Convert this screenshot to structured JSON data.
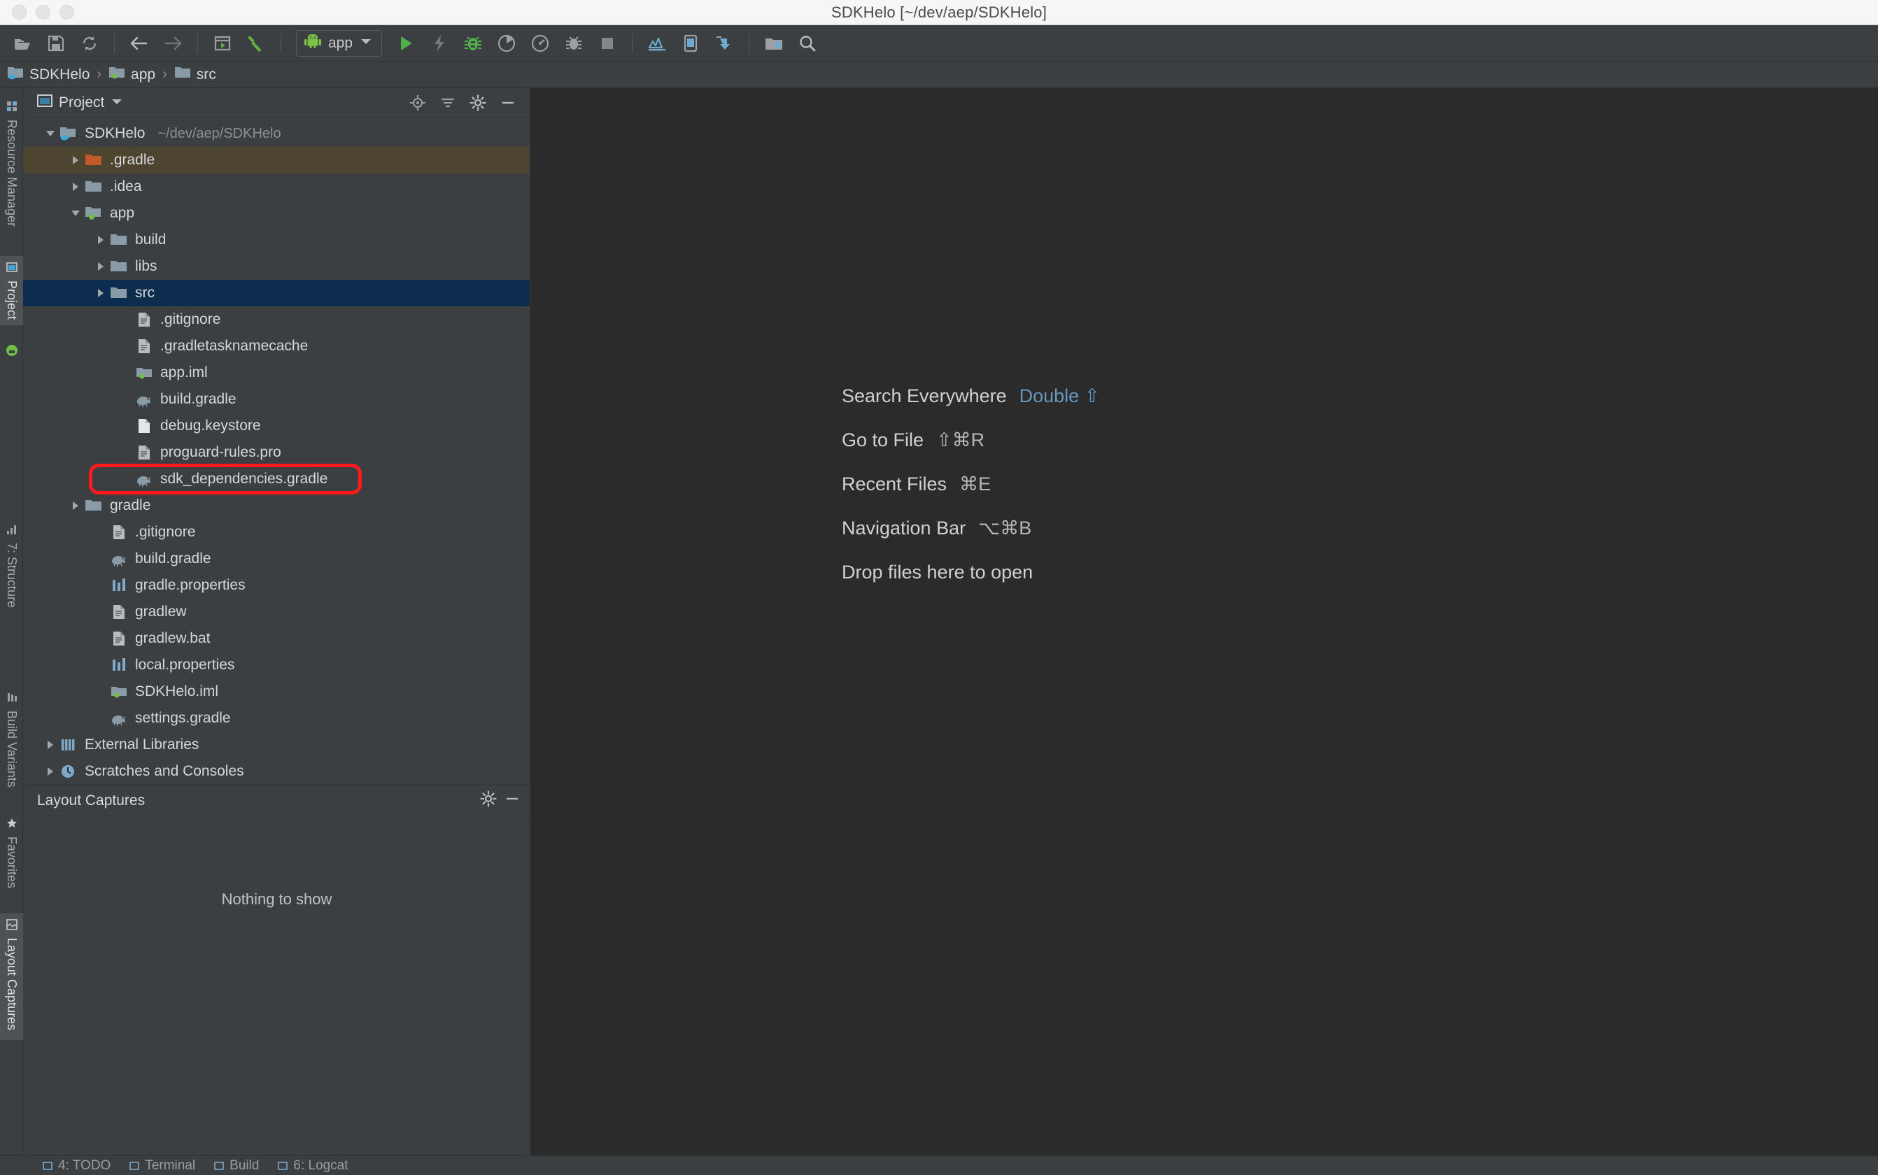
{
  "window": {
    "title": "SDKHelo [~/dev/aep/SDKHelo]",
    "controls": [
      "close-button",
      "minimize-button",
      "zoom-button"
    ]
  },
  "toolbar": {
    "buttons": [
      {
        "name": "open-project-icon",
        "tooltip": "Open"
      },
      {
        "name": "save-all-icon",
        "tooltip": "Save All"
      },
      {
        "name": "sync-icon",
        "tooltip": "Synchronize"
      },
      {
        "name": "back-arrow-icon",
        "tooltip": "Back"
      },
      {
        "name": "forward-arrow-icon",
        "tooltip": "Forward"
      },
      {
        "name": "project-structure-icon",
        "tooltip": "Project Structure"
      },
      {
        "name": "build-hammer-icon",
        "tooltip": "Make Project"
      },
      {
        "name": "run-icon",
        "tooltip": "Run"
      },
      {
        "name": "apply-changes-icon",
        "tooltip": "Apply Changes"
      },
      {
        "name": "debug-icon",
        "tooltip": "Debug"
      },
      {
        "name": "run-coverage-icon",
        "tooltip": "Run with Coverage"
      },
      {
        "name": "profiler-icon",
        "tooltip": "Profile"
      },
      {
        "name": "attach-debugger-icon",
        "tooltip": "Attach Debugger"
      },
      {
        "name": "stop-icon",
        "tooltip": "Stop"
      },
      {
        "name": "sdk-manager-icon",
        "tooltip": "SDK Manager"
      },
      {
        "name": "avd-manager-icon",
        "tooltip": "AVD Manager"
      },
      {
        "name": "sync-gradle-icon",
        "tooltip": "Sync Project with Gradle Files"
      },
      {
        "name": "device-file-explorer-icon",
        "tooltip": "Device File Explorer"
      },
      {
        "name": "search-everywhere-icon",
        "tooltip": "Search Everywhere"
      }
    ],
    "run_config": {
      "label": "app",
      "icon": "android-robot-icon",
      "dropdown": "chevron-down-icon"
    }
  },
  "breadcrumb": {
    "items": [
      {
        "label": "SDKHelo",
        "icon": "module-java-folder-icon"
      },
      {
        "label": "app",
        "icon": "module-android-folder-icon"
      },
      {
        "label": "src",
        "icon": "folder-icon"
      }
    ],
    "separator": "›"
  },
  "left_stripe": {
    "tabs": [
      {
        "label": "Resource Manager",
        "selected": false,
        "icon": "resource-manager-icon"
      },
      {
        "label": "Project",
        "selected": true,
        "icon": "project-icon"
      },
      {
        "label": "7: Structure",
        "selected": false,
        "icon": "structure-icon"
      },
      {
        "label": "Build Variants",
        "selected": false,
        "icon": "build-variants-icon"
      },
      {
        "label": "Favorites",
        "selected": false,
        "icon": "star-icon"
      },
      {
        "label": "Layout Captures",
        "selected": true,
        "icon": "layout-captures-icon"
      }
    ]
  },
  "project_panel": {
    "title": "Project",
    "title_dropdown": "chevron-down-icon",
    "header_actions": [
      {
        "name": "locate-icon",
        "label": "Select Opened File"
      },
      {
        "name": "collapse-all-icon",
        "label": "Collapse All"
      },
      {
        "name": "gear-icon",
        "label": "Settings"
      },
      {
        "name": "minimize-icon",
        "label": "Hide"
      }
    ],
    "tree": [
      {
        "label": "SDKHelo",
        "path": "~/dev/aep/SDKHelo",
        "indent": 0,
        "arrow": "down",
        "icon": "module-java-folder-icon",
        "state": "none"
      },
      {
        "label": ".gradle",
        "path": "",
        "indent": 1,
        "arrow": "right",
        "icon": "folder-orange-icon",
        "state": "brown"
      },
      {
        "label": ".idea",
        "path": "",
        "indent": 1,
        "arrow": "right",
        "icon": "folder-icon",
        "state": "none"
      },
      {
        "label": "app",
        "path": "",
        "indent": 1,
        "arrow": "down",
        "icon": "module-android-folder-icon",
        "state": "none"
      },
      {
        "label": "build",
        "path": "",
        "indent": 2,
        "arrow": "right",
        "icon": "folder-icon",
        "state": "none"
      },
      {
        "label": "libs",
        "path": "",
        "indent": 2,
        "arrow": "right",
        "icon": "folder-icon",
        "state": "none"
      },
      {
        "label": "src",
        "path": "",
        "indent": 2,
        "arrow": "right",
        "icon": "folder-icon",
        "state": "blue"
      },
      {
        "label": ".gitignore",
        "path": "",
        "indent": 3,
        "arrow": "none",
        "icon": "text-file-icon",
        "state": "none"
      },
      {
        "label": ".gradletasknamecache",
        "path": "",
        "indent": 3,
        "arrow": "none",
        "icon": "text-file-icon",
        "state": "none"
      },
      {
        "label": "app.iml",
        "path": "",
        "indent": 3,
        "arrow": "none",
        "icon": "iml-file-icon",
        "state": "none"
      },
      {
        "label": "build.gradle",
        "path": "",
        "indent": 3,
        "arrow": "none",
        "icon": "gradle-file-icon",
        "state": "none"
      },
      {
        "label": "debug.keystore",
        "path": "",
        "indent": 3,
        "arrow": "none",
        "icon": "blank-file-icon",
        "state": "none"
      },
      {
        "label": "proguard-rules.pro",
        "path": "",
        "indent": 3,
        "arrow": "none",
        "icon": "text-file-icon",
        "state": "none"
      },
      {
        "label": "sdk_dependencies.gradle",
        "path": "",
        "indent": 3,
        "arrow": "none",
        "icon": "gradle-file-icon",
        "state": "annotated"
      },
      {
        "label": "gradle",
        "path": "",
        "indent": 1,
        "arrow": "right",
        "icon": "folder-icon",
        "state": "none"
      },
      {
        "label": ".gitignore",
        "path": "",
        "indent": 2,
        "arrow": "none",
        "icon": "text-file-icon",
        "state": "none"
      },
      {
        "label": "build.gradle",
        "path": "",
        "indent": 2,
        "arrow": "none",
        "icon": "gradle-file-icon",
        "state": "none"
      },
      {
        "label": "gradle.properties",
        "path": "",
        "indent": 2,
        "arrow": "none",
        "icon": "properties-file-icon",
        "state": "none"
      },
      {
        "label": "gradlew",
        "path": "",
        "indent": 2,
        "arrow": "none",
        "icon": "text-file-icon",
        "state": "none"
      },
      {
        "label": "gradlew.bat",
        "path": "",
        "indent": 2,
        "arrow": "none",
        "icon": "text-file-icon",
        "state": "none"
      },
      {
        "label": "local.properties",
        "path": "",
        "indent": 2,
        "arrow": "none",
        "icon": "properties-file-icon",
        "state": "none"
      },
      {
        "label": "SDKHelo.iml",
        "path": "",
        "indent": 2,
        "arrow": "none",
        "icon": "iml-file-icon",
        "state": "none"
      },
      {
        "label": "settings.gradle",
        "path": "",
        "indent": 2,
        "arrow": "none",
        "icon": "gradle-file-icon",
        "state": "none"
      },
      {
        "label": "External Libraries",
        "path": "",
        "indent": 0,
        "arrow": "right",
        "icon": "libraries-icon",
        "state": "none"
      },
      {
        "label": "Scratches and Consoles",
        "path": "",
        "indent": 0,
        "arrow": "right",
        "icon": "scratches-icon",
        "state": "none"
      }
    ],
    "annotation": {
      "color": "#ff1b1b",
      "target": "sdk_dependencies.gradle"
    }
  },
  "layout_captures": {
    "title": "Layout Captures",
    "empty_text": "Nothing to show",
    "actions": [
      {
        "name": "gear-icon",
        "label": "Settings"
      },
      {
        "name": "minimize-icon",
        "label": "Hide"
      }
    ]
  },
  "editor": {
    "hints": [
      {
        "label": "Search Everywhere",
        "key": "Double ⇧",
        "accent": true
      },
      {
        "label": "Go to File",
        "key": "⇧⌘R",
        "accent": false
      },
      {
        "label": "Recent Files",
        "key": "⌘E",
        "accent": false
      },
      {
        "label": "Navigation Bar",
        "key": "⌥⌘B",
        "accent": false
      },
      {
        "label": "Drop files here to open",
        "key": "",
        "accent": false
      }
    ]
  },
  "status_bar": {
    "items": [
      {
        "label": "4: TODO",
        "icon": "todo-icon"
      },
      {
        "label": "Terminal",
        "icon": "terminal-icon"
      },
      {
        "label": "Build",
        "icon": "build-icon"
      },
      {
        "label": "6: Logcat",
        "icon": "logcat-icon"
      }
    ]
  },
  "colors": {
    "toolbar_bg": "#3c3f41",
    "editor_bg": "#2b2b2b",
    "selection_blue": "#0d2d4e",
    "highlight_brown": "#4d452f",
    "accent_link": "#6897bb",
    "android_green": "#6fbf4a",
    "annotation_red": "#ff1b1b",
    "folder_gray": "#8a9ba8",
    "folder_orange": "#c1592a"
  }
}
